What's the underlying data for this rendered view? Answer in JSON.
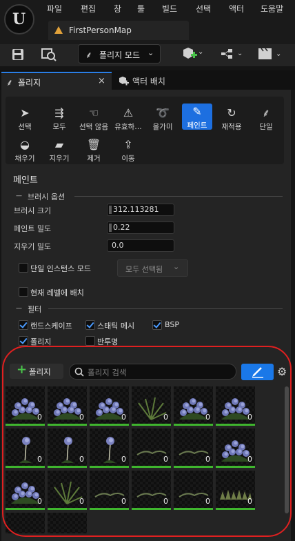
{
  "menu": [
    "파일",
    "편집",
    "창",
    "툴",
    "빌드",
    "선택",
    "액터",
    "도움말"
  ],
  "document_tab": "FirstPersonMap",
  "toolbar": {
    "mode_label": "폴리지 모드"
  },
  "panel_tabs": {
    "foliage": "폴리지",
    "close": "×",
    "actor_placement": "액터 배치"
  },
  "tools": [
    {
      "label": "선택",
      "icon": "cursor-icon"
    },
    {
      "label": "모두",
      "icon": "select-all-icon"
    },
    {
      "label": "선택 않음",
      "icon": "deselect-icon"
    },
    {
      "label": "유효하…",
      "icon": "invalid-select-icon"
    },
    {
      "label": "올가미",
      "icon": "lasso-icon"
    },
    {
      "label": "페인트",
      "icon": "brush-icon",
      "active": true
    },
    {
      "label": "재적용",
      "icon": "reapply-icon"
    },
    {
      "label": "단일",
      "icon": "single-icon"
    },
    {
      "label": "채우기",
      "icon": "fill-icon"
    },
    {
      "label": "지우기",
      "icon": "erase-icon"
    },
    {
      "label": "제거",
      "icon": "trash-icon"
    },
    {
      "label": "이동",
      "icon": "move-icon"
    }
  ],
  "paint": {
    "title": "페인트",
    "brush_options": "브러시 옵션",
    "brush_size_label": "브러시 크기",
    "brush_size": "312.113281",
    "paint_density_label": "페인트 밀도",
    "paint_density": "0.22",
    "erase_density_label": "지우기 밀도",
    "erase_density": "0.0",
    "single_instance_label": "단일 인스턴스 모드",
    "select_all_dropdown": "모두 선택됨",
    "place_in_current_level": "현재 레벨에 배치"
  },
  "filters": {
    "title": "필터",
    "landscape": "랜드스케이프",
    "static_mesh": "스태틱 메시",
    "bsp": "BSP",
    "foliage": "폴리지",
    "translucent": "반투명"
  },
  "list": {
    "add_button": "폴리지",
    "search_placeholder": "폴리지 검색",
    "items": [
      {
        "count": "0",
        "kind": "flower-bush"
      },
      {
        "count": "0",
        "kind": "flower-bush"
      },
      {
        "count": "0",
        "kind": "flower-bush"
      },
      {
        "count": "0",
        "kind": "fern"
      },
      {
        "count": "0",
        "kind": "flower-bush"
      },
      {
        "count": "0",
        "kind": "flower-bush"
      },
      {
        "count": "0",
        "kind": "tall-flower"
      },
      {
        "count": "0",
        "kind": "tall-flower"
      },
      {
        "count": "0",
        "kind": "tall-flower"
      },
      {
        "count": "0",
        "kind": "grass-strip"
      },
      {
        "count": "0",
        "kind": "grass-strip"
      },
      {
        "count": "0",
        "kind": "flower-bush"
      },
      {
        "count": "0",
        "kind": "flower-bush"
      },
      {
        "count": "0",
        "kind": "fern"
      },
      {
        "count": "0",
        "kind": "grass-strip"
      },
      {
        "count": "0",
        "kind": "grass-strip"
      },
      {
        "count": "0",
        "kind": "grass-strip"
      },
      {
        "count": "0",
        "kind": "grass-clump"
      },
      {
        "count": "",
        "kind": "empty"
      },
      {
        "count": "",
        "kind": "empty"
      }
    ]
  },
  "colors": {
    "accent": "#1d6fe0",
    "highlight": "#e02020",
    "green": "#3fb52e"
  }
}
